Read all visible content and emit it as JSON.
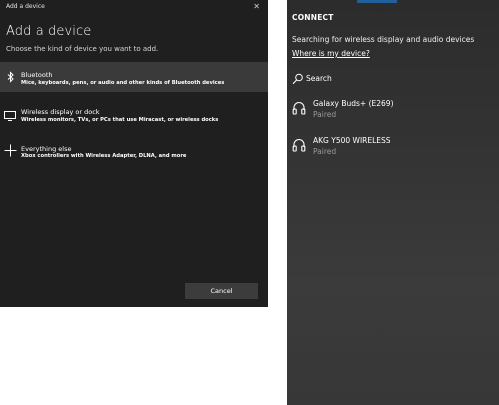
{
  "add_device_dialog": {
    "window_title": "Add a device",
    "close_glyph": "✕",
    "heading": "Add a device",
    "instruction": "Choose the kind of device you want to add.",
    "options": [
      {
        "name": "Bluetooth",
        "description": "Mice, keyboards, pens, or audio and other kinds of Bluetooth devices",
        "icon": "bluetooth-icon",
        "selected": true
      },
      {
        "name": "Wireless display or dock",
        "description": "Wireless monitors, TVs, or PCs that use Miracast, or wireless docks",
        "icon": "monitor-icon",
        "selected": false
      },
      {
        "name": "Everything else",
        "description": "Xbox controllers with Wireless Adapter, DLNA, and more",
        "icon": "plus-icon",
        "selected": false
      }
    ],
    "cancel_label": "Cancel"
  },
  "connect_pane": {
    "heading": "CONNECT",
    "searching_text": "Searching for wireless display and audio devices",
    "where_link": "Where is my device?",
    "search_label": "Search",
    "devices": [
      {
        "name": "Galaxy Buds+ (E269)",
        "status": "Paired",
        "icon": "headphones-icon"
      },
      {
        "name": "AKG Y500 WIRELESS",
        "status": "Paired",
        "icon": "headphones-icon"
      }
    ]
  },
  "colors": {
    "dialog_bg": "#1f1f1f",
    "selected_bg": "#3a3a3a",
    "pane_bg": "#333333",
    "secondary_text": "#9a9a9a",
    "accent": "#1e6fb8"
  }
}
